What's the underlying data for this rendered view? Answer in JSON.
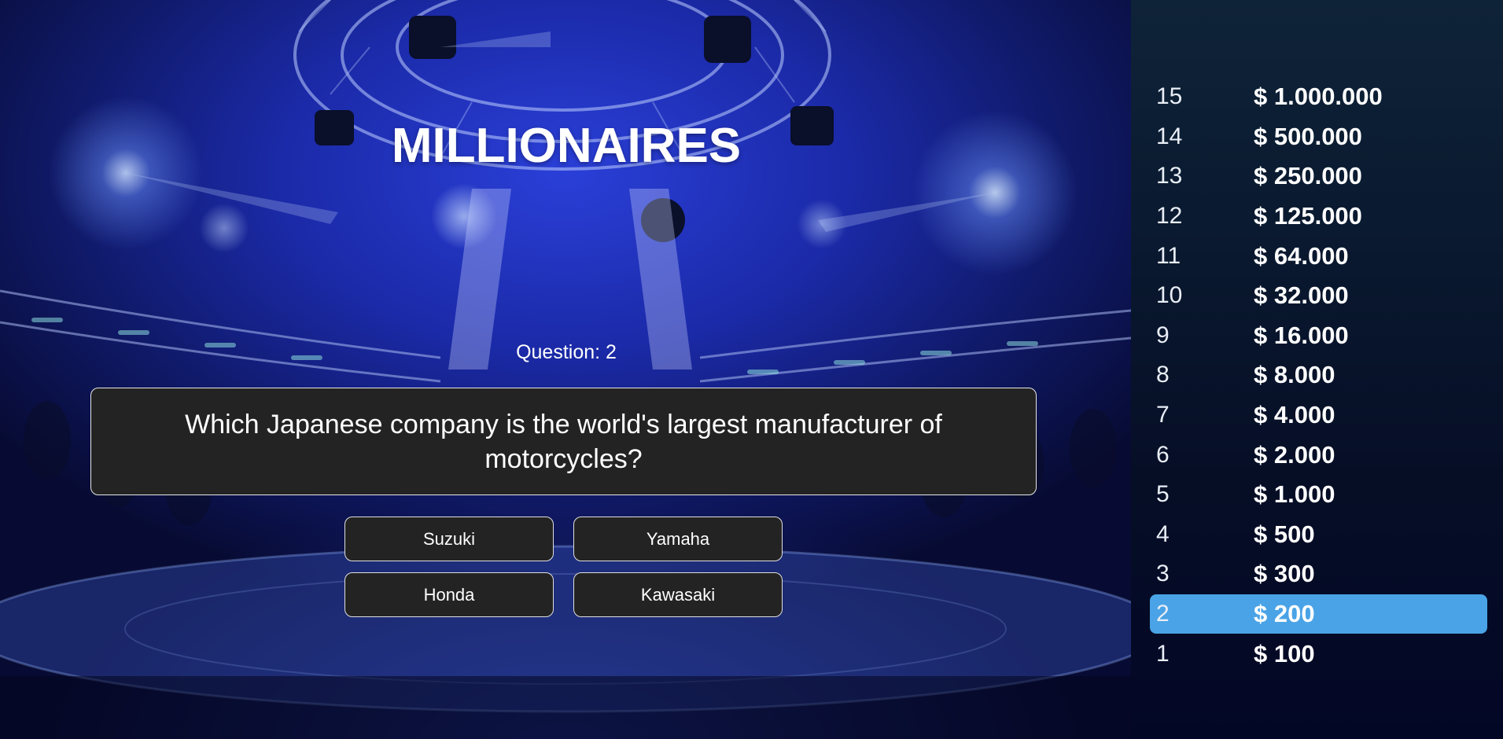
{
  "game": {
    "title": "MILLIONAIRES",
    "question_number_label": "Question: 2",
    "question_text": "Which Japanese company is the world's largest manufacturer of motorcycles?"
  },
  "answers": [
    {
      "label": "Suzuki"
    },
    {
      "label": "Yamaha"
    },
    {
      "label": "Honda"
    },
    {
      "label": "Kawasaki"
    }
  ],
  "money_ladder": {
    "current_level": 2,
    "levels": [
      {
        "number": "15",
        "amount": "$ 1.000.000"
      },
      {
        "number": "14",
        "amount": "$ 500.000"
      },
      {
        "number": "13",
        "amount": "$ 250.000"
      },
      {
        "number": "12",
        "amount": "$ 125.000"
      },
      {
        "number": "11",
        "amount": "$ 64.000"
      },
      {
        "number": "10",
        "amount": "$ 32.000"
      },
      {
        "number": "9",
        "amount": "$ 16.000"
      },
      {
        "number": "8",
        "amount": "$ 8.000"
      },
      {
        "number": "7",
        "amount": "$ 4.000"
      },
      {
        "number": "6",
        "amount": "$ 2.000"
      },
      {
        "number": "5",
        "amount": "$ 1.000"
      },
      {
        "number": "4",
        "amount": "$ 500"
      },
      {
        "number": "3",
        "amount": "$ 300"
      },
      {
        "number": "2",
        "amount": "$ 200"
      },
      {
        "number": "1",
        "amount": "$ 100"
      }
    ]
  },
  "colors": {
    "highlight": "#4aa3e6",
    "box_background": "#232323",
    "sidebar_background": "#0a1a30"
  }
}
